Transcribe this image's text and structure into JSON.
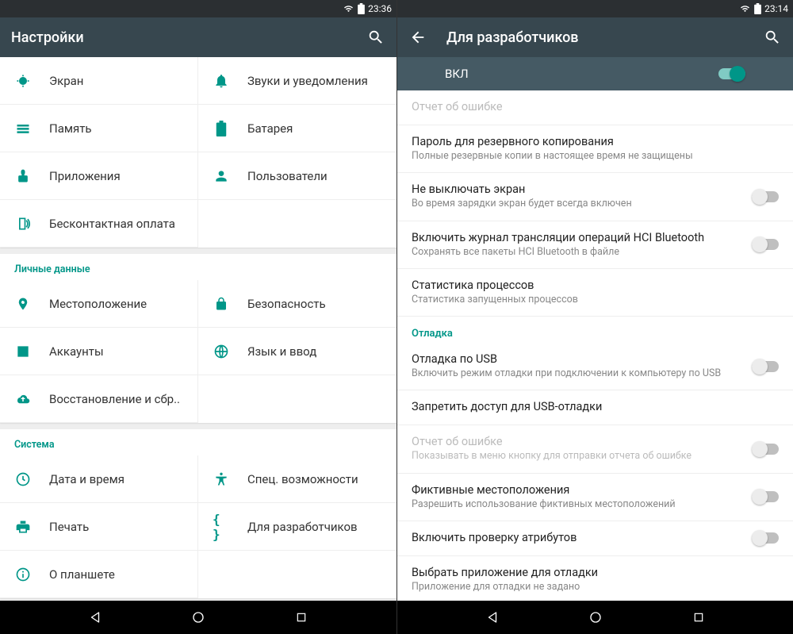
{
  "left": {
    "status_time": "23:36",
    "title": "Настройки",
    "groups": [
      {
        "category": null,
        "items": [
          {
            "icon": "display",
            "label": "Экран"
          },
          {
            "icon": "bell",
            "label": "Звуки и уведомления"
          },
          {
            "icon": "memory",
            "label": "Память"
          },
          {
            "icon": "battery",
            "label": "Батарея"
          },
          {
            "icon": "apps",
            "label": "Приложения"
          },
          {
            "icon": "user",
            "label": "Пользователи"
          },
          {
            "icon": "nfc",
            "label": "Бесконтактная оплата"
          }
        ]
      },
      {
        "category": "Личные данные",
        "items": [
          {
            "icon": "location",
            "label": "Местоположение"
          },
          {
            "icon": "lock",
            "label": "Безопасность"
          },
          {
            "icon": "account",
            "label": "Аккаунты"
          },
          {
            "icon": "globe",
            "label": "Язык и ввод"
          },
          {
            "icon": "backup",
            "label": "Восстановление и сбр.."
          }
        ]
      },
      {
        "category": "Система",
        "items": [
          {
            "icon": "clock",
            "label": "Дата и время"
          },
          {
            "icon": "a11y",
            "label": "Спец. возможности"
          },
          {
            "icon": "print",
            "label": "Печать"
          },
          {
            "icon": "braces",
            "label": "Для разработчиков"
          },
          {
            "icon": "info",
            "label": "О планшете"
          }
        ]
      }
    ]
  },
  "right": {
    "status_time": "23:14",
    "title": "Для разработчиков",
    "master_toggle": {
      "label": "ВКЛ",
      "on": true
    },
    "rows": [
      {
        "title": "Отчет об ошибке",
        "sub": null,
        "disabled": true,
        "switch": null
      },
      {
        "title": "Пароль для резервного копирования",
        "sub": "Полные резервные копии в настоящее время не защищены",
        "switch": null
      },
      {
        "title": "Не выключать экран",
        "sub": "Во время зарядки экран будет всегда включен",
        "switch": false
      },
      {
        "title": "Включить журнал трансляции операций HCI Bluetooth",
        "sub": "Сохранять все пакеты HCI Bluetooth в файле",
        "switch": false
      },
      {
        "title": "Статистика процессов",
        "sub": "Статистика запущенных процессов",
        "switch": null
      },
      {
        "section": "Отладка"
      },
      {
        "title": "Отладка по USB",
        "sub": "Включить режим отладки при подключении к компьютеру по USB",
        "switch": false
      },
      {
        "title": "Запретить доступ для USB-отладки",
        "sub": null,
        "switch": null
      },
      {
        "title": "Отчет об ошибке",
        "sub": "Показывать в меню кнопку для отправки отчета об ошибке",
        "disabled": true,
        "switch": false
      },
      {
        "title": "Фиктивные местоположения",
        "sub": "Разрешить использование фиктивных местоположений",
        "switch": false
      },
      {
        "title": "Включить проверку атрибутов",
        "sub": null,
        "switch": false
      },
      {
        "title": "Выбрать приложение для отладки",
        "sub": "Приложение для отладки не задано",
        "switch": null
      }
    ]
  }
}
